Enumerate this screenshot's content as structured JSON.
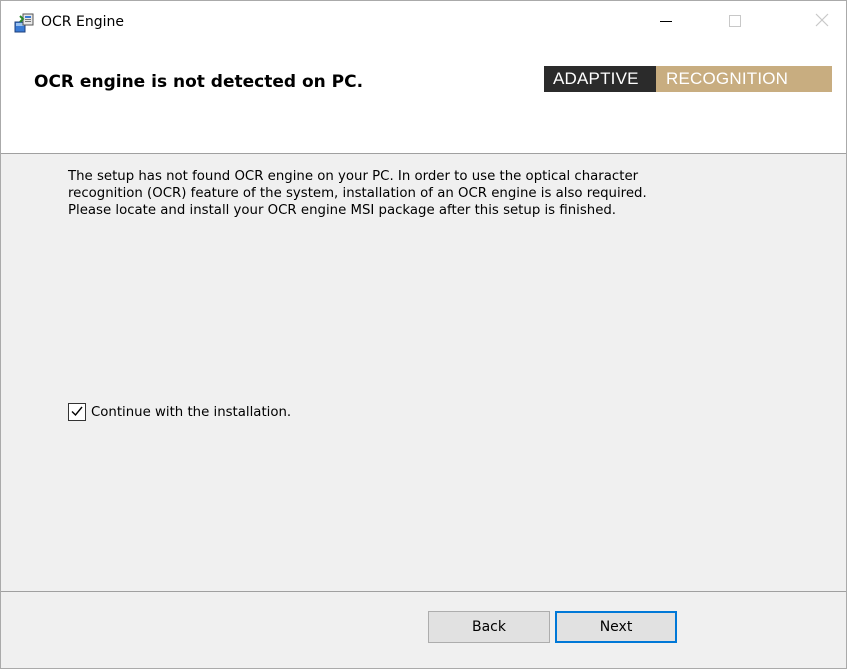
{
  "window": {
    "title": "OCR Engine"
  },
  "header": {
    "title": "OCR engine is not detected on PC.",
    "logo_left": "ADAPTIVE",
    "logo_right": "RECOGNITION"
  },
  "body": {
    "message_line1": "The setup has not found OCR engine on your PC. In order to use the optical character",
    "message_line2": "recognition (OCR) feature of the system, installation of an OCR engine is also required.",
    "message_line3": "Please locate and install your OCR engine MSI package after this setup is finished.",
    "checkbox_label": "Continue with the installation.",
    "checkbox_checked": true
  },
  "footer": {
    "back_label": "Back",
    "next_label": "Next"
  },
  "colors": {
    "logo_dark": "#2b2b2b",
    "logo_gold": "#c8ad80",
    "focus_blue": "#0078d7",
    "panel_gray": "#f0f0f0"
  },
  "icons": {
    "app": "installer-package-icon",
    "minimize": "minimize-icon",
    "maximize": "maximize-icon",
    "close": "close-icon",
    "check": "checkmark-icon"
  }
}
